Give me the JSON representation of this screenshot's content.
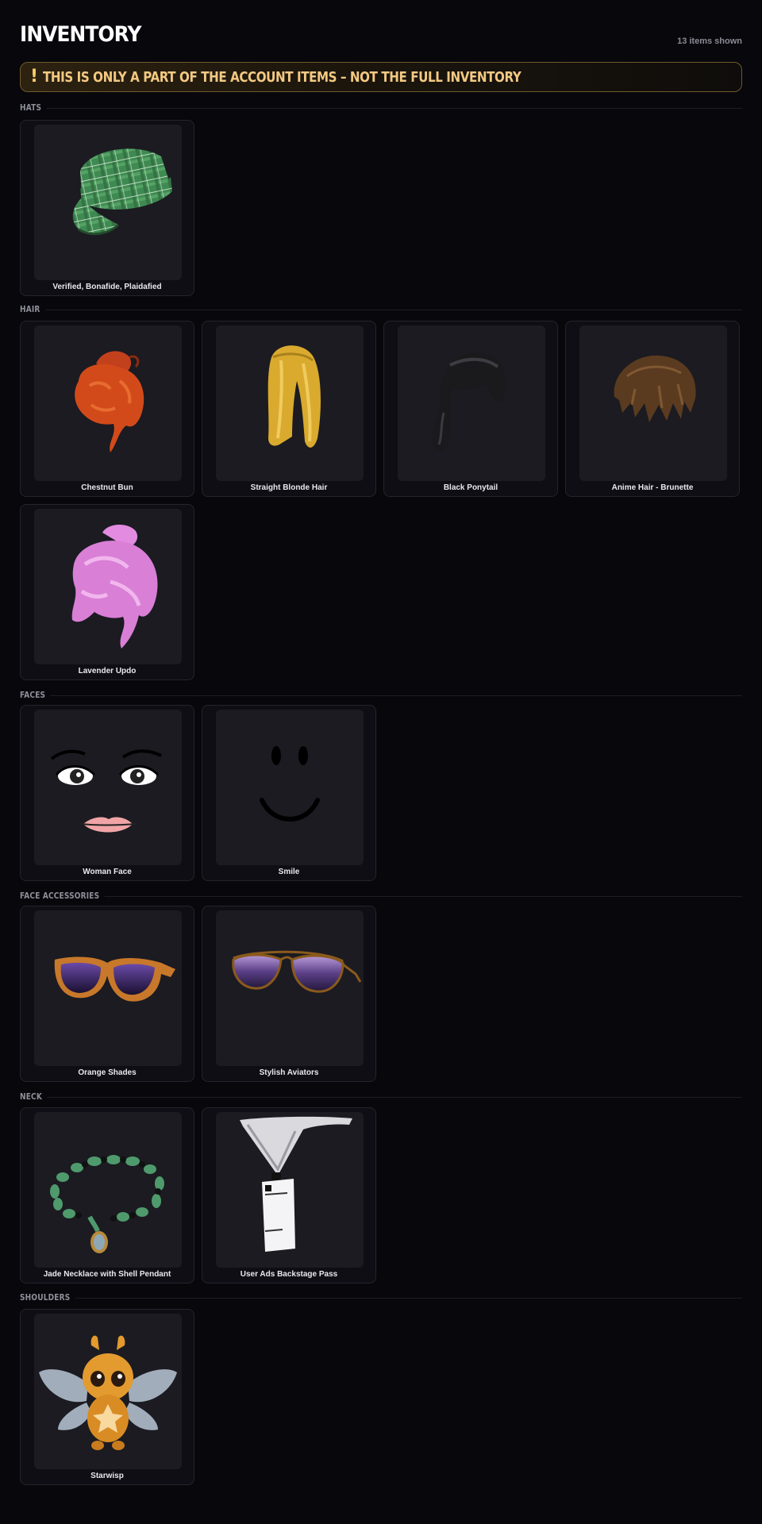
{
  "header": {
    "title": "INVENTORY",
    "count": "13 items shown"
  },
  "banner": {
    "icon": "exclamation-icon",
    "icon_glyph": "!",
    "text": "THIS IS ONLY A PART OF THE ACCOUNT ITEMS – NOT THE FULL INVENTORY"
  },
  "sections": [
    {
      "label": "HATS",
      "items": [
        {
          "name": "Verified, Bonafide, Plaidafied",
          "icon": "plaid-cap-icon"
        }
      ]
    },
    {
      "label": "HAIR",
      "items": [
        {
          "name": "Chestnut Bun",
          "icon": "chestnut-bun-hair-icon"
        },
        {
          "name": "Straight Blonde Hair",
          "icon": "blonde-hair-icon"
        },
        {
          "name": "Black Ponytail",
          "icon": "black-ponytail-icon"
        },
        {
          "name": "Anime Hair - Brunette",
          "icon": "brunette-hair-icon"
        },
        {
          "name": "Lavender Updo",
          "icon": "lavender-updo-icon"
        }
      ]
    },
    {
      "label": "FACES",
      "items": [
        {
          "name": "Woman Face",
          "icon": "woman-face-icon"
        },
        {
          "name": "Smile",
          "icon": "smile-face-icon"
        }
      ]
    },
    {
      "label": "FACE ACCESSORIES",
      "items": [
        {
          "name": "Orange Shades",
          "icon": "orange-shades-icon"
        },
        {
          "name": "Stylish Aviators",
          "icon": "aviators-icon"
        }
      ]
    },
    {
      "label": "NECK",
      "items": [
        {
          "name": "Jade Necklace with Shell Pendant",
          "icon": "jade-necklace-icon"
        },
        {
          "name": "User Ads Backstage Pass",
          "icon": "backstage-pass-icon"
        }
      ]
    },
    {
      "label": "SHOULDERS",
      "items": [
        {
          "name": "Starwisp",
          "icon": "starwisp-icon"
        }
      ]
    }
  ]
}
